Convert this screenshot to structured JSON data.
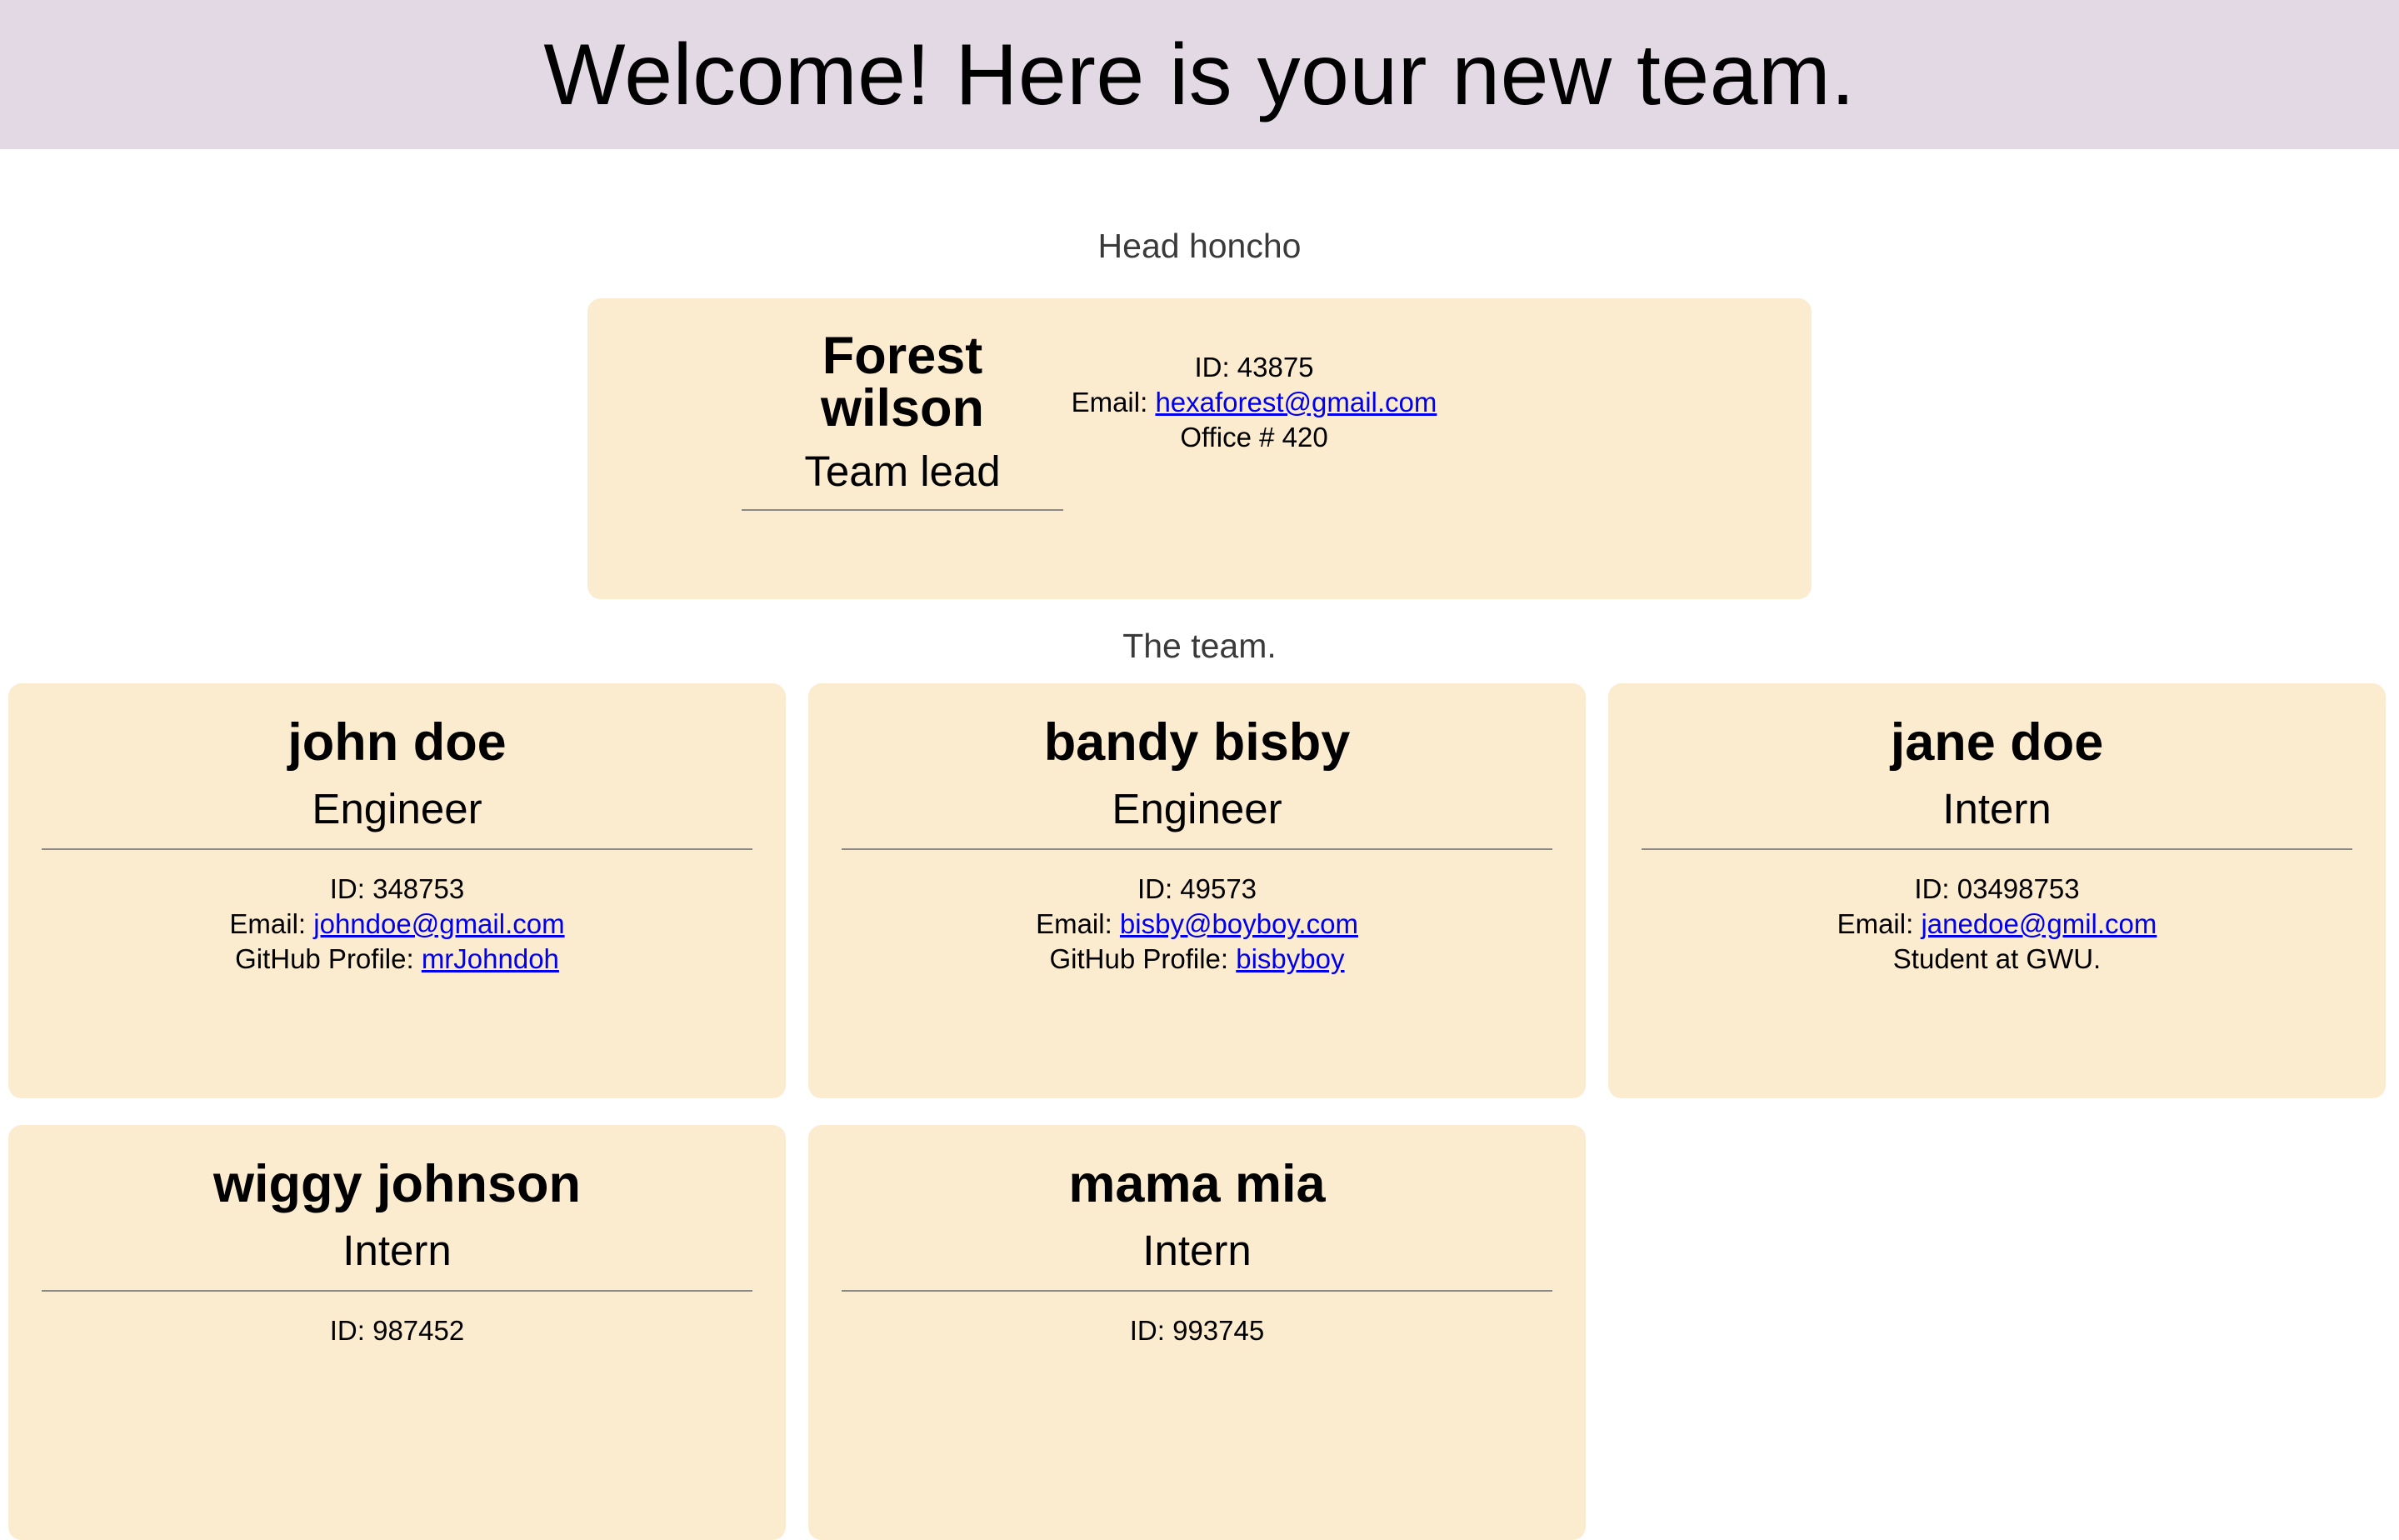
{
  "header": {
    "title": "Welcome! Here is your new team."
  },
  "manager_section": {
    "label": "Head honcho"
  },
  "manager": {
    "name": "Forest wilson",
    "role": "Team lead",
    "id_text": "ID: 43875",
    "email_prefix": "Email: ",
    "email": "hexaforest@gmail.com",
    "office_text": "Office # 420"
  },
  "team_section": {
    "label": "The team."
  },
  "team": [
    {
      "name": "john doe",
      "role": "Engineer",
      "id_text": "ID: 348753",
      "email_prefix": "Email: ",
      "email": "johndoe@gmail.com",
      "extra_prefix": "GitHub Profile: ",
      "extra_link": "mrJohndoh"
    },
    {
      "name": "bandy bisby",
      "role": "Engineer",
      "id_text": "ID: 49573",
      "email_prefix": "Email: ",
      "email": "bisby@boyboy.com",
      "extra_prefix": "GitHub Profile: ",
      "extra_link": "bisbyboy"
    },
    {
      "name": "jane doe",
      "role": "Intern",
      "id_text": "ID: 03498753",
      "email_prefix": "Email: ",
      "email": "janedoe@gmil.com",
      "extra_text": "Student at GWU."
    },
    {
      "name": "wiggy johnson",
      "role": "Intern",
      "id_text": "ID: 987452"
    },
    {
      "name": "mama mia",
      "role": "Intern",
      "id_text": "ID: 993745"
    }
  ]
}
